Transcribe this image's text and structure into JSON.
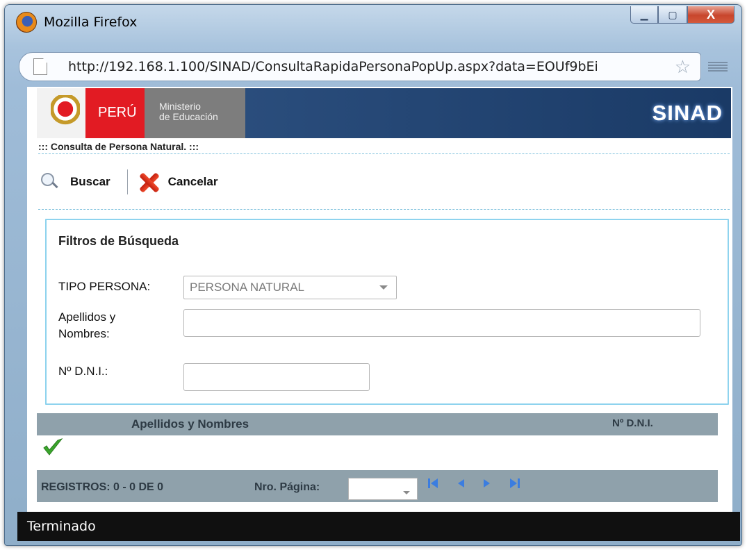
{
  "window": {
    "title": "Mozilla Firefox",
    "minimize_label": "▁",
    "maximize_label": "▢",
    "close_label": "X"
  },
  "address_bar": {
    "url": "http://192.168.1.100/SINAD/ConsultaRapidaPersonaPopUp.aspx?data=EOUf9bEi"
  },
  "banner": {
    "country": "PERÚ",
    "ministry_line1": "Ministerio",
    "ministry_line2": "de Educación",
    "system": "SINAD"
  },
  "page_heading": "::: Consulta de Persona Natural. :::",
  "toolbar": {
    "search_label": "Buscar",
    "cancel_label": "Cancelar"
  },
  "filters": {
    "title": "Filtros de Búsqueda",
    "tipo_persona_label": "TIPO PERSONA:",
    "tipo_persona_value": "PERSONA NATURAL",
    "nombres_label_line1": "Apellidos y",
    "nombres_label_line2": "Nombres:",
    "nombres_value": "",
    "dni_label": "Nº D.N.I.:",
    "dni_value": ""
  },
  "grid": {
    "columns": [
      "Apellidos y Nombres",
      "Nº D.N.I."
    ],
    "rows": []
  },
  "pager": {
    "records": "REGISTROS: 0 - 0 DE 0",
    "page_label": "Nro. Página:",
    "page_value": ""
  },
  "status": {
    "text": "Terminado"
  },
  "colors": {
    "grid_bar": "#8fa1ab",
    "banner_red": "#e21b23",
    "banner_blue": "#1a3a66",
    "filter_border": "#8ed3ee",
    "pager_arrow": "#3b7de0"
  }
}
